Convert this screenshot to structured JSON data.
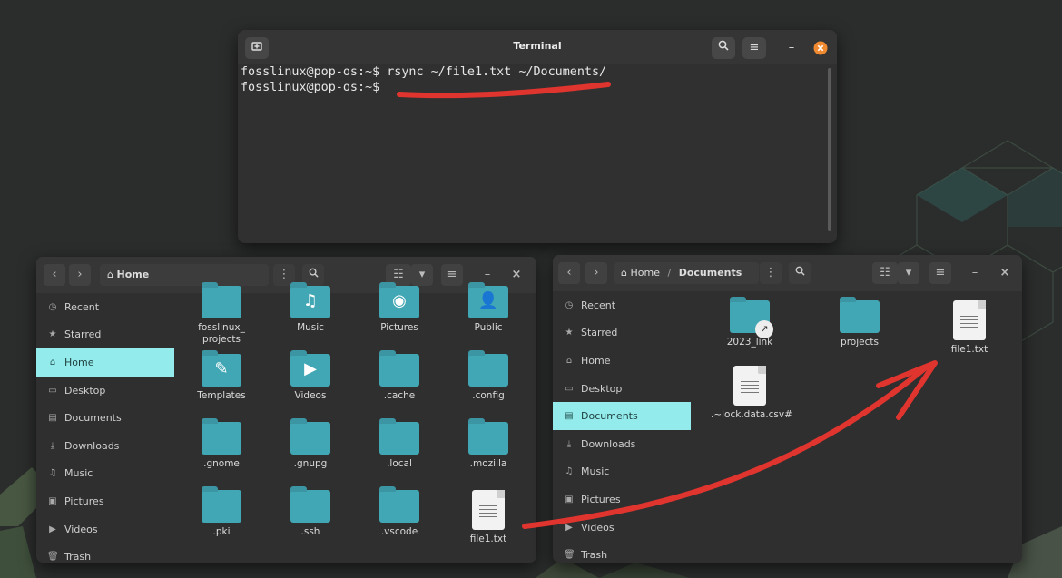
{
  "colors": {
    "accent": "#94ebeb",
    "folder": "#42a7b5",
    "annotation": "#e0342f",
    "close": "#f08a31"
  },
  "terminal": {
    "title": "Terminal",
    "lines": [
      "fosslinux@pop-os:~$ rsync ~/file1.txt ~/Documents/",
      "fosslinux@pop-os:~$"
    ],
    "icons": {
      "new_tab": "new-tab-icon",
      "search": "search-icon",
      "menu": "hamburger-menu-icon",
      "minimize": "minimize-icon",
      "close": "close-icon"
    }
  },
  "left_window": {
    "path": [
      "Home"
    ],
    "sidebar": [
      {
        "label": "Recent",
        "icon": "clock-icon"
      },
      {
        "label": "Starred",
        "icon": "star-icon"
      },
      {
        "label": "Home",
        "icon": "home-icon",
        "active": true
      },
      {
        "label": "Desktop",
        "icon": "desktop-icon"
      },
      {
        "label": "Documents",
        "icon": "document-icon"
      },
      {
        "label": "Downloads",
        "icon": "download-icon"
      },
      {
        "label": "Music",
        "icon": "music-icon"
      },
      {
        "label": "Pictures",
        "icon": "picture-icon"
      },
      {
        "label": "Videos",
        "icon": "video-icon"
      },
      {
        "label": "Trash",
        "icon": "trash-icon"
      }
    ],
    "items": [
      {
        "label": "fosslinux_\nprojects",
        "type": "folder"
      },
      {
        "label": "Music",
        "type": "folder",
        "emblem": "music-icon"
      },
      {
        "label": "Pictures",
        "type": "folder",
        "emblem": "camera-icon"
      },
      {
        "label": "Public",
        "type": "folder",
        "emblem": "person-icon"
      },
      {
        "label": "Templates",
        "type": "folder",
        "emblem": "template-icon"
      },
      {
        "label": "Videos",
        "type": "folder",
        "emblem": "video-icon"
      },
      {
        "label": ".cache",
        "type": "folder"
      },
      {
        "label": ".config",
        "type": "folder"
      },
      {
        "label": ".gnome",
        "type": "folder"
      },
      {
        "label": ".gnupg",
        "type": "folder"
      },
      {
        "label": ".local",
        "type": "folder"
      },
      {
        "label": ".mozilla",
        "type": "folder"
      },
      {
        "label": ".pki",
        "type": "folder"
      },
      {
        "label": ".ssh",
        "type": "folder"
      },
      {
        "label": ".vscode",
        "type": "folder"
      },
      {
        "label": "file1.txt",
        "type": "text-file"
      }
    ]
  },
  "right_window": {
    "path": [
      "Home",
      "/",
      "Documents"
    ],
    "sidebar": [
      {
        "label": "Recent",
        "icon": "clock-icon"
      },
      {
        "label": "Starred",
        "icon": "star-icon"
      },
      {
        "label": "Home",
        "icon": "home-icon"
      },
      {
        "label": "Desktop",
        "icon": "desktop-icon"
      },
      {
        "label": "Documents",
        "icon": "document-icon",
        "active": true
      },
      {
        "label": "Downloads",
        "icon": "download-icon"
      },
      {
        "label": "Music",
        "icon": "music-icon"
      },
      {
        "label": "Pictures",
        "icon": "picture-icon"
      },
      {
        "label": "Videos",
        "icon": "video-icon"
      },
      {
        "label": "Trash",
        "icon": "trash-icon"
      }
    ],
    "items": [
      {
        "label": "2023_link",
        "type": "folder-link"
      },
      {
        "label": "projects",
        "type": "folder"
      },
      {
        "label": "file1.txt",
        "type": "text-file"
      },
      {
        "label": ".~lock.data.csv#",
        "type": "text-file"
      }
    ]
  }
}
